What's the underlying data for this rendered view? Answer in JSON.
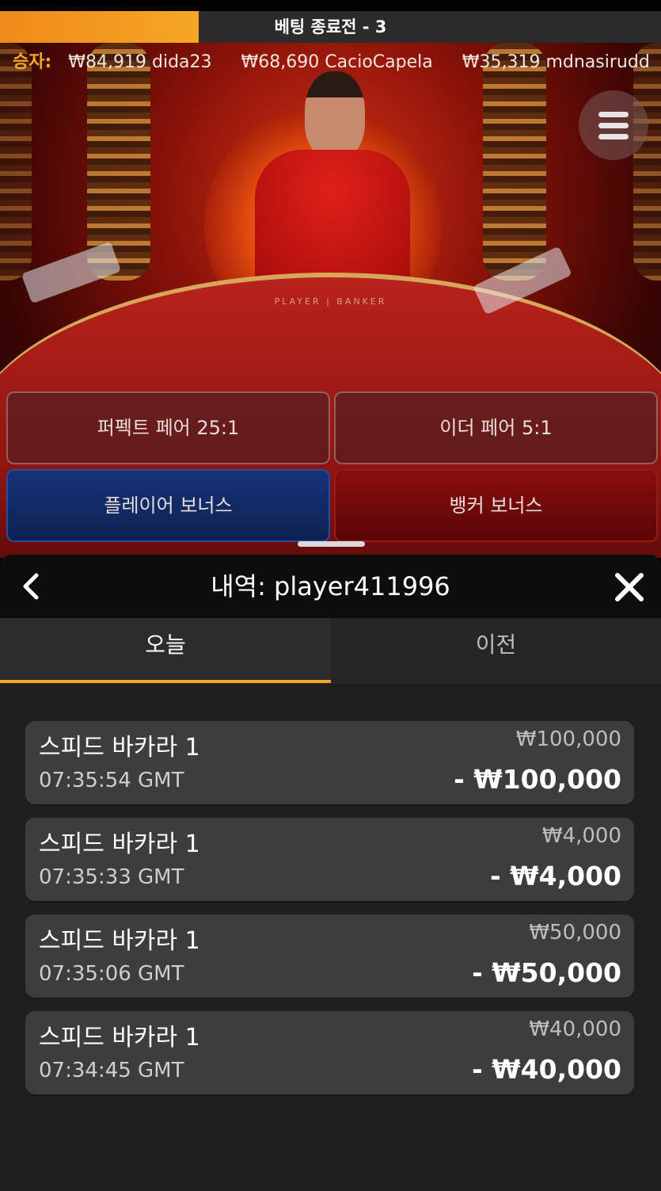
{
  "colors": {
    "accent": "#f5a623",
    "sheet_bg": "#1f1f1f",
    "card_bg": "#3d3d3d"
  },
  "timer": {
    "label": "베팅 종료전 - 3",
    "progress": 0.3
  },
  "winners": {
    "label": "승자:",
    "items": [
      {
        "amount": "₩84,919",
        "name": "dida23"
      },
      {
        "amount": "₩68,690",
        "name": "CacioCapela"
      },
      {
        "amount": "₩35,319",
        "name": "mdnasirudd"
      }
    ]
  },
  "table": {
    "label": "PLAYER | BANKER"
  },
  "menu": {
    "icon": "hamburger-icon"
  },
  "bets": {
    "perfect_pair": "퍼펙트 페어 25:1",
    "either_pair": "이더 페어 5:1",
    "player_bonus": "플레이어 보너스",
    "banker_bonus": "뱅커 보너스"
  },
  "history": {
    "title": "내역: player411996",
    "back_icon": "chevron-left-icon",
    "close_icon": "close-icon",
    "tabs": [
      {
        "label": "오늘",
        "active": true
      },
      {
        "label": "이전",
        "active": false
      }
    ],
    "entries": [
      {
        "game": "스피드 바카라 1",
        "time": "07:35:54 GMT",
        "stake": "₩100,000",
        "result": "- ₩100,000"
      },
      {
        "game": "스피드 바카라 1",
        "time": "07:35:33 GMT",
        "stake": "₩4,000",
        "result": "- ₩4,000"
      },
      {
        "game": "스피드 바카라 1",
        "time": "07:35:06 GMT",
        "stake": "₩50,000",
        "result": "- ₩50,000"
      },
      {
        "game": "스피드 바카라 1",
        "time": "07:34:45 GMT",
        "stake": "₩40,000",
        "result": "- ₩40,000"
      }
    ]
  }
}
